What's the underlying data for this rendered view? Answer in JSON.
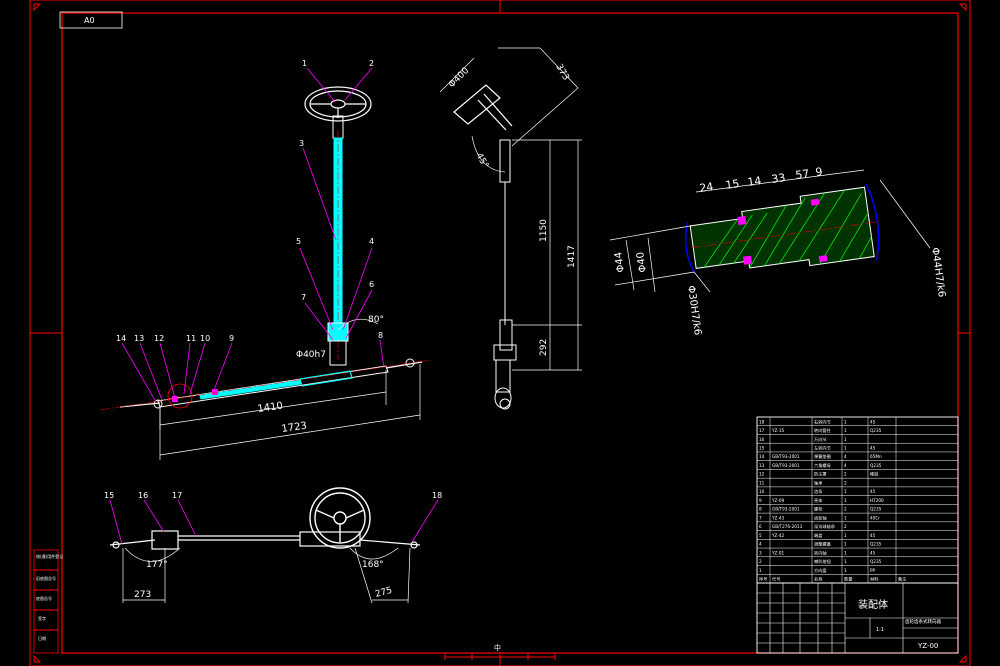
{
  "sheet": {
    "format_label": "A0",
    "title_block": {
      "drawing_name": "装配体",
      "drawing_number": "YZ-00",
      "subtitle": "齿轮齿条式转向器",
      "scale": "1:1"
    }
  },
  "views": {
    "front": {
      "part_balloons": [
        "1",
        "2",
        "3",
        "4",
        "5",
        "6",
        "7",
        "8",
        "9",
        "10",
        "11",
        "12",
        "13",
        "14"
      ],
      "dims": {
        "fit": "Φ40h7",
        "angle": "80°",
        "inner_length": "1410",
        "overall_length": "1723"
      }
    },
    "side": {
      "dims": {
        "wheel_dia": "Φ400",
        "wheel_offset": "373",
        "tilt": "45°",
        "column": "1150",
        "total": "1417",
        "lower": "292"
      }
    },
    "section": {
      "dims_top": [
        "24",
        "15",
        "14",
        "33",
        "57",
        "9"
      ],
      "dims_side": {
        "left_outer": "Φ44",
        "left_inner": "Φ40",
        "fit_left": "Φ30H7/k6",
        "fit_right": "Φ44H7/k6"
      }
    },
    "top": {
      "part_balloons": [
        "15",
        "16",
        "17",
        "18"
      ],
      "dims": {
        "left_angle": "177°",
        "right_angle": "168°",
        "left_len": "273",
        "right_len": "275"
      }
    }
  },
  "bom": {
    "header": [
      "序号",
      "代号",
      "名称",
      "数量",
      "材料",
      "备注"
    ],
    "rows": [
      [
        "18",
        "",
        "右转向节",
        "1",
        "45",
        ""
      ],
      [
        "17",
        "YZ-15",
        "转向管柱",
        "1",
        "Q235",
        ""
      ],
      [
        "16",
        "",
        "万向节",
        "1",
        "",
        ""
      ],
      [
        "15",
        "",
        "左转向节",
        "1",
        "45",
        ""
      ],
      [
        "14",
        "GB/T93-2001",
        "弹簧垫圈",
        "4",
        "65Mn",
        ""
      ],
      [
        "13",
        "GB/T93-2001",
        "六角螺母",
        "4",
        "Q235",
        ""
      ],
      [
        "12",
        "",
        "防尘罩",
        "2",
        "橡胶",
        ""
      ],
      [
        "11",
        "",
        "轴承",
        "2",
        "",
        ""
      ],
      [
        "10",
        "",
        "齿条",
        "1",
        "45",
        ""
      ],
      [
        "9",
        "YZ-09",
        "壳体",
        "1",
        "HT200",
        ""
      ],
      [
        "8",
        "GB/T93-2001",
        "螺栓",
        "2",
        "Q235",
        ""
      ],
      [
        "7",
        "YZ-43",
        "齿轮轴",
        "1",
        "40Cr",
        ""
      ],
      [
        "6",
        "GB/T276-2013",
        "深沟球轴承",
        "2",
        "",
        ""
      ],
      [
        "5",
        "YZ-42",
        "端盖",
        "1",
        "45",
        ""
      ],
      [
        "4",
        "",
        "调整螺塞",
        "1",
        "Q235",
        ""
      ],
      [
        "3",
        "YZ-01",
        "转向轴",
        "1",
        "45",
        ""
      ],
      [
        "2",
        "",
        "喇叭按钮",
        "1",
        "Q235",
        ""
      ],
      [
        "1",
        "",
        "方向盘",
        "1",
        "PP",
        ""
      ]
    ]
  },
  "left_margin_labels": [
    "借(通)用件登记",
    "旧底图总号",
    "底图总号",
    "签字",
    "日期"
  ],
  "bottom_center_mark": "中",
  "colors": {
    "frame": "#ff0000",
    "line": "#ffffff",
    "shaft": "#00ffff",
    "dim": "#00ff00",
    "leader": "#ff00ff",
    "hatch": "#00ff00",
    "hidden": "#0000ff"
  }
}
